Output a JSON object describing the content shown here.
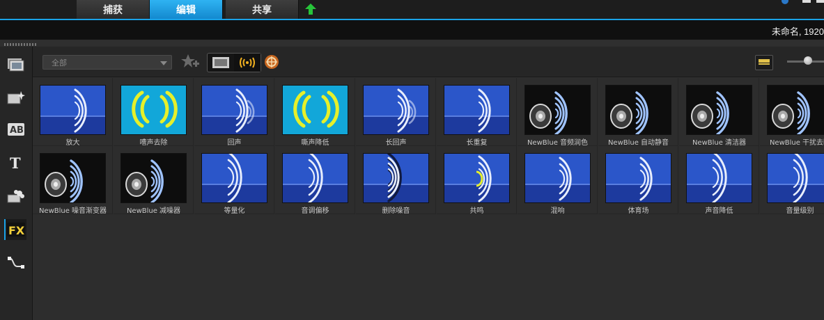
{
  "tabs": [
    {
      "label": "捕获",
      "active": false
    },
    {
      "label": "编辑",
      "active": true
    },
    {
      "label": "共享",
      "active": false
    }
  ],
  "project_title": "未命名, 1920",
  "toolbar": {
    "filter_value": "全部",
    "add_favorite_icon": "star-plus-icon",
    "view_icons": [
      "film-strip-icon",
      "audio-wave-icon"
    ],
    "extra_icon": "wheel-icon"
  },
  "sidebar": [
    {
      "icon": "media-icon"
    },
    {
      "icon": "instant-project-icon"
    },
    {
      "icon": "transition-icon"
    },
    {
      "icon": "title-icon"
    },
    {
      "icon": "graphic-icon"
    },
    {
      "icon": "fx-icon",
      "label": "FX",
      "active": true
    },
    {
      "icon": "path-icon"
    }
  ],
  "colors": {
    "accent": "#1aa3e8",
    "thumb_blue": "#2b56c9",
    "thumb_cyan": "#12a7d9",
    "thumb_dark": "#0d0d0d",
    "wave_white": "#e8eefc",
    "wave_yellow": "#e6f02a"
  },
  "filters": [
    {
      "label": "放大",
      "style": "blue"
    },
    {
      "label": "嘈声去除",
      "style": "cyan"
    },
    {
      "label": "回声",
      "style": "blue-echo"
    },
    {
      "label": "嘶声降低",
      "style": "cyan"
    },
    {
      "label": "长回声",
      "style": "blue-echo"
    },
    {
      "label": "长重复",
      "style": "blue"
    },
    {
      "label": "NewBlue 音频润色",
      "style": "speaker"
    },
    {
      "label": "NewBlue 自动静音",
      "style": "speaker"
    },
    {
      "label": "NewBlue 清洁器",
      "style": "speaker"
    },
    {
      "label": "NewBlue 干扰去除",
      "style": "speaker"
    },
    {
      "label": "NewBlue 噪音渐变器",
      "style": "speaker"
    },
    {
      "label": "NewBlue 减噪器",
      "style": "speaker"
    },
    {
      "label": "等量化",
      "style": "blue-wide"
    },
    {
      "label": "音调偏移",
      "style": "blue-wide"
    },
    {
      "label": "删除噪音",
      "style": "blue-noise"
    },
    {
      "label": "共鸣",
      "style": "blue-yellow"
    },
    {
      "label": "混响",
      "style": "blue"
    },
    {
      "label": "体育场",
      "style": "blue-stadium"
    },
    {
      "label": "声音降低",
      "style": "blue-wide"
    },
    {
      "label": "音量级别",
      "style": "blue-wide"
    }
  ]
}
